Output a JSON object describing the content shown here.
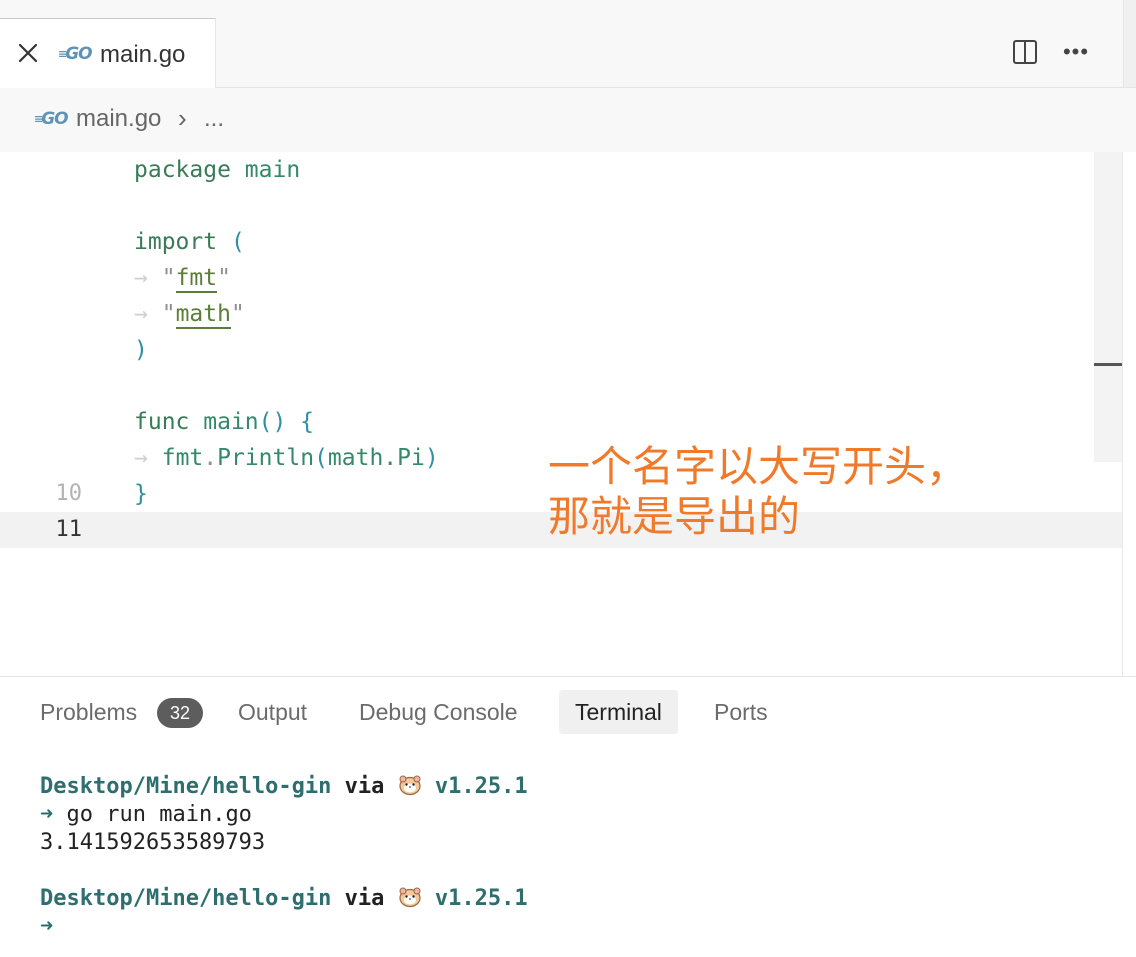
{
  "tab": {
    "label": "main.go",
    "logo": "GO"
  },
  "breadcrumb": {
    "file": "main.go",
    "separator": "›",
    "more": "..."
  },
  "editor": {
    "lines": {
      "l1": {
        "kw": "package",
        "name": "main"
      },
      "l3": {
        "kw": "import",
        "paren": "("
      },
      "l4": {
        "q1": "\"",
        "pkg": "fmt",
        "q2": "\""
      },
      "l5": {
        "q1": "\"",
        "pkg": "math",
        "q2": "\""
      },
      "l6": {
        "paren": ")"
      },
      "l8": {
        "kw": "func",
        "name": "main",
        "rest": "() {"
      },
      "l9": {
        "obj": "fmt",
        "dot": ".",
        "fn": "Println",
        "open": "(",
        "arg": "math.Pi",
        "close": ")"
      },
      "l10": {
        "brace": "}"
      }
    },
    "line_numbers": {
      "n10": "10",
      "n11": "11"
    },
    "annotation": {
      "line1": "一个名字以大写开头，",
      "line2": "那就是导出的"
    }
  },
  "panel": {
    "tabs": {
      "problems": "Problems",
      "problems_count": "32",
      "output": "Output",
      "debug_console": "Debug Console",
      "terminal": "Terminal",
      "ports": "Ports"
    },
    "terminal": {
      "prompt1": {
        "path": "Desktop/Mine/hello-gin",
        "via": "via",
        "version": "v1.25.1"
      },
      "cmd": {
        "arrow": "➜",
        "text": "go run main.go"
      },
      "output": "3.141592653589793",
      "prompt2": {
        "path": "Desktop/Mine/hello-gin",
        "via": "via",
        "version": "v1.25.1"
      },
      "cursor_arrow": "➜"
    }
  },
  "colors": {
    "annotation": "#f07a2a",
    "terminal_path": "#2e6e6e",
    "badge": "#5d5d5d"
  },
  "icons": [
    "close-icon",
    "go-file-icon",
    "split-editor-icon",
    "more-actions-icon",
    "hamster-icon"
  ]
}
